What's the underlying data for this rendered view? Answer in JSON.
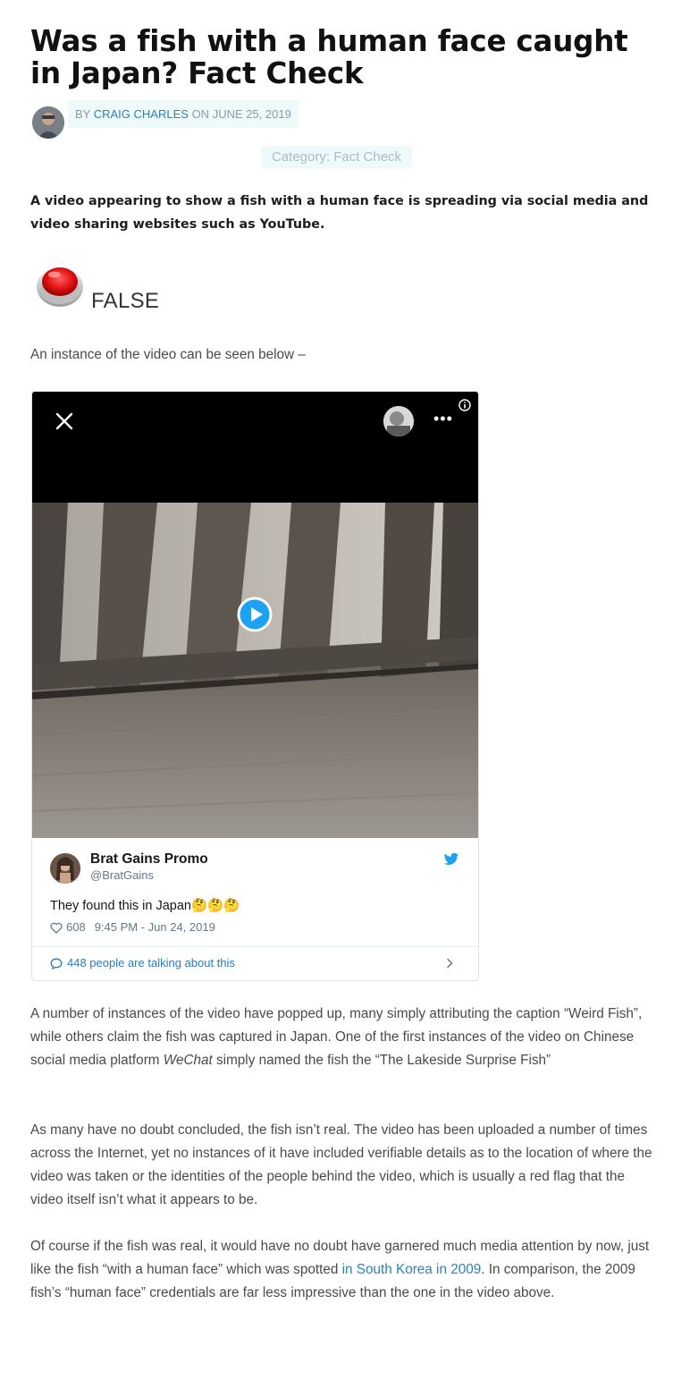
{
  "article": {
    "title": "Was a fish with a human face caught in Japan? Fact Check",
    "byline_prefix": "BY",
    "author": "CRAIG CHARLES",
    "date_prefix": "ON",
    "date": "JUNE 25, 2019",
    "category": "Category: Fact Check",
    "lead": "A video appearing to show a fish with a human face is spreading via social media and video sharing websites such as YouTube.",
    "verdict": "FALSE",
    "intro": "An instance of the video can be seen below –",
    "para1_a": "A number of instances of the video have popped up, many simply attributing the caption “Weird Fish”, while others claim the fish was captured in Japan. One of the first instances of the video on Chinese social media platform ",
    "para1_em": "WeChat",
    "para1_b": " simply named the fish the “The Lakeside Surprise Fish”",
    "para2": "As many have no doubt concluded, the fish isn’t real. The video has been uploaded a number of times across the Internet, yet no instances of it have included verifiable details as to the location of where the video was taken or the identities of the people behind the video, which is usually a red flag that the video itself isn’t what it appears to be.",
    "para3_a": "Of course if the fish was real, it would have no doubt have garnered much media attention by now, just like the fish “with a human face” which was spotted ",
    "para3_link": "in South Korea in 2009",
    "para3_b": ". In comparison, the 2009 fish’s “human face” credentials are far less impressive than the one in the video above."
  },
  "tweet": {
    "name": "Brat Gains Promo",
    "handle": "@BratGains",
    "text": "They found this in Japan🤔🤔🤔",
    "likes": "608",
    "timestamp": "9:45 PM - Jun 24, 2019",
    "talking": "448 people are talking about this",
    "more_label": "•••"
  },
  "colors": {
    "link": "#2e82b8",
    "verdict_red": "#e01010",
    "badge_bg": "#eef9f9",
    "twitter_blue": "#1da1f2"
  }
}
